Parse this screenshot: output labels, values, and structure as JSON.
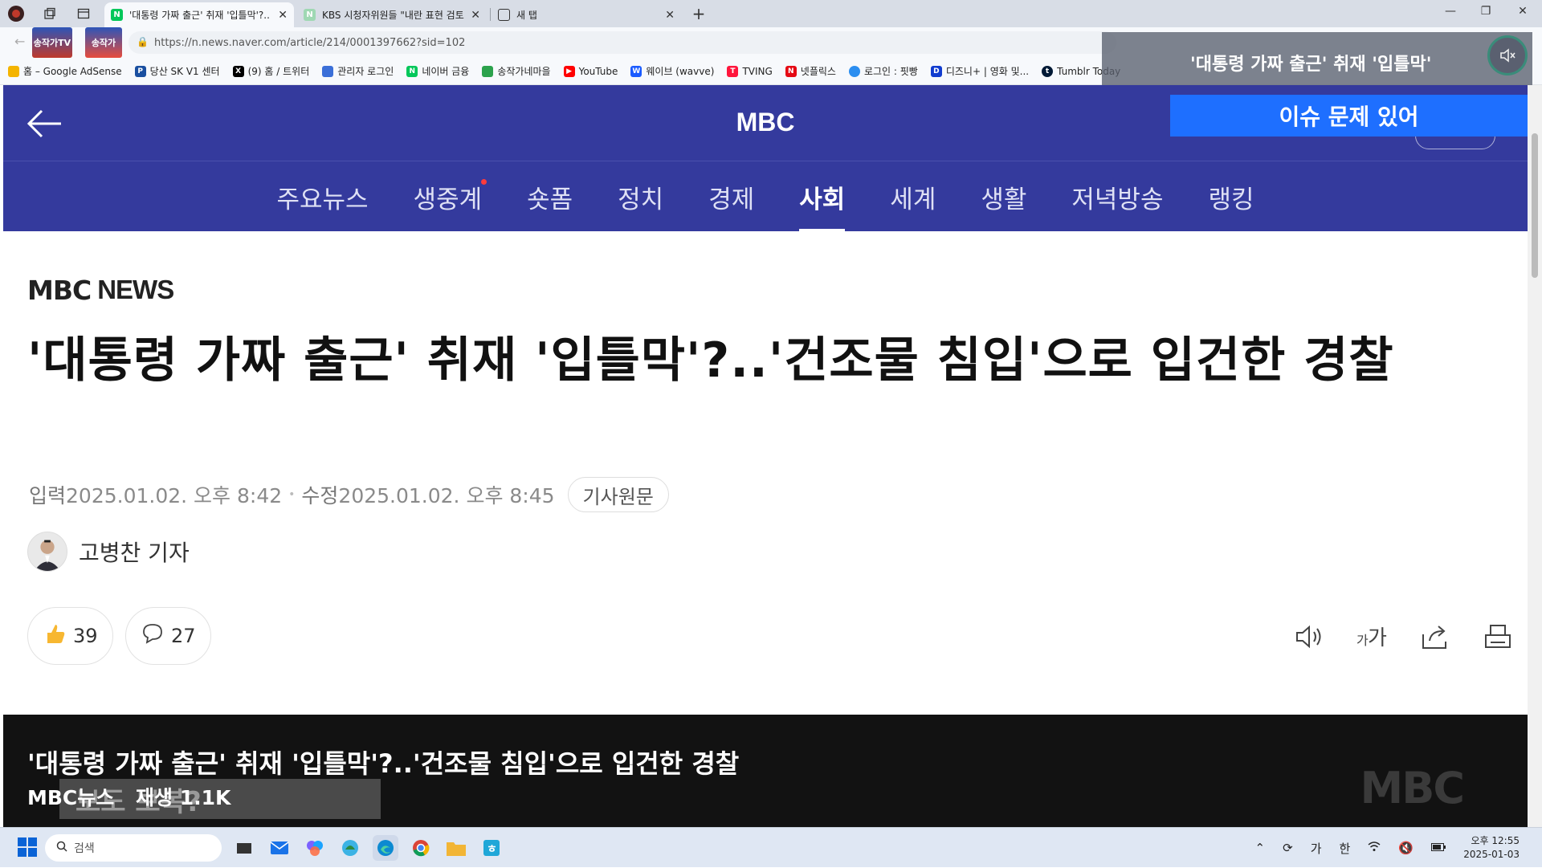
{
  "browser": {
    "tabs": [
      {
        "title": "'대통령 가짜 출근' 취재 '입틀막'?..",
        "favicon": "N",
        "active": true
      },
      {
        "title": "KBS 시청자위원들 \"내란 표현 검토",
        "favicon": "N",
        "active": false
      },
      {
        "title": "새 탭",
        "favicon": "□",
        "active": false
      }
    ],
    "new_tab_label": "+",
    "url": "https://n.news.naver.com/article/214/0001397662?sid=102",
    "bookmarks": [
      {
        "label": "홈 – Google AdSense",
        "icon_color": "#f4b400"
      },
      {
        "label": "당산 SK V1 센터",
        "icon_color": "#1a4fa0"
      },
      {
        "label": "(9) 홈 / 트위터",
        "icon_color": "#000000"
      },
      {
        "label": "관리자 로그인",
        "icon_color": "#3b6fd8"
      },
      {
        "label": "네이버 금융",
        "icon_color": "#03c75a"
      },
      {
        "label": "송작가네마을",
        "icon_color": "#2ca24c"
      },
      {
        "label": "YouTube",
        "icon_color": "#ff0000"
      },
      {
        "label": "웨이브 (wavve)",
        "icon_color": "#1a5bff"
      },
      {
        "label": "TVING",
        "icon_color": "#ff153c"
      },
      {
        "label": "넷플릭스",
        "icon_color": "#e50914"
      },
      {
        "label": "로그인 : 핏빵",
        "icon_color": "#2b8ef0"
      },
      {
        "label": "디즈니+ | 영화 및...",
        "icon_color": "#113ccf"
      },
      {
        "label": "Tumblr Today",
        "icon_color": "#001935"
      }
    ],
    "pip_title": "'대통령 가짜 출근' 취재 '입틀막'",
    "thumbs": [
      "송작가TV",
      "송작가"
    ]
  },
  "header": {
    "title": "MBC",
    "issue_button": "이슈 문제 있어"
  },
  "categories": [
    {
      "label": "주요뉴스",
      "active": false,
      "dot": false
    },
    {
      "label": "생중계",
      "active": false,
      "dot": true
    },
    {
      "label": "숏폼",
      "active": false,
      "dot": false
    },
    {
      "label": "정치",
      "active": false,
      "dot": false
    },
    {
      "label": "경제",
      "active": false,
      "dot": false
    },
    {
      "label": "사회",
      "active": true,
      "dot": false
    },
    {
      "label": "세계",
      "active": false,
      "dot": false
    },
    {
      "label": "생활",
      "active": false,
      "dot": false
    },
    {
      "label": "저녁방송",
      "active": false,
      "dot": false
    },
    {
      "label": "랭킹",
      "active": false,
      "dot": false
    }
  ],
  "article": {
    "press_logo_mbc": "MBC",
    "press_logo_news": "NEWS",
    "headline": "'대통령 가짜 출근' 취재 '입틀막'?..'건조물 침입'으로 입건한 경찰",
    "input_label": "입력",
    "input_date": "2025.01.02. 오후 8:42",
    "edit_label": "수정",
    "edit_date": "2025.01.02. 오후 8:45",
    "original_button": "기사원문",
    "reporter": "고병찬 기자",
    "like_count": "39",
    "comment_count": "27"
  },
  "video": {
    "title": "'대통령 가짜 출근' 취재 '입틀막'?..'건조물 침입'으로 입건한 경찰",
    "channel": "MBC뉴스",
    "plays": "재생 1.1K",
    "bg_caption": "보도 보복?",
    "watermark": "MBC"
  },
  "taskbar": {
    "search_placeholder": "검색",
    "ime_1": "가",
    "ime_2": "한",
    "time": "오후 12:55",
    "date": "2025-01-03"
  },
  "colors": {
    "header_bg": "#343a9d",
    "issue_btn": "#1e6fff"
  }
}
